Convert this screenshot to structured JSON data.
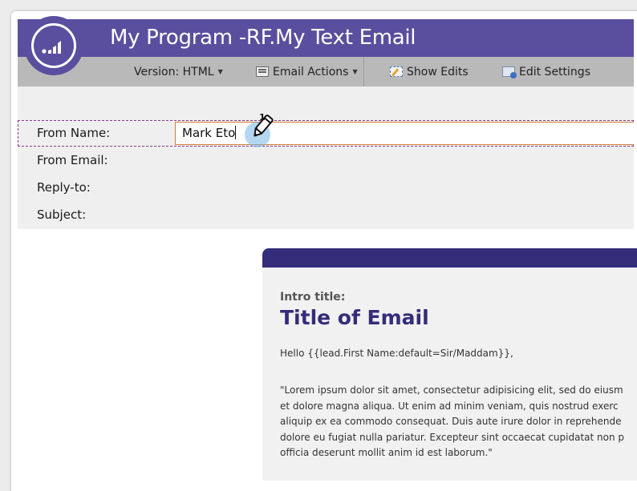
{
  "header": {
    "title": "My Program -RF.My Text Email",
    "brand_color": "#5a4e9f"
  },
  "toolbar": {
    "version_label": "Version: HTML",
    "email_actions_label": "Email Actions",
    "show_edits_label": "Show Edits",
    "edit_settings_label": "Edit Settings"
  },
  "form": {
    "from_name_label": "From Name:",
    "from_name_value": "Mark Eto",
    "from_email_label": "From Email:",
    "reply_to_label": "Reply-to:",
    "subject_label": "Subject:"
  },
  "cursor": {
    "badge": "1",
    "icon": "pencil-cursor-icon"
  },
  "email": {
    "accent_color": "#352c7a",
    "intro_label": "Intro title:",
    "title": "Title of Email",
    "greeting": "Hello {{lead.First Name:default=Sir/Maddam}},",
    "body_lines": [
      "\"Lorem ipsum dolor sit amet, consectetur adipisicing elit, sed do eiusm",
      "et dolore magna aliqua. Ut enim ad minim veniam, quis nostrud exerc",
      "aliquip ex ea commodo consequat. Duis aute irure dolor in reprehende",
      "dolore eu fugiat nulla pariatur. Excepteur sint occaecat cupidatat non p",
      "officia deserunt mollit anim id est laborum.\""
    ]
  }
}
